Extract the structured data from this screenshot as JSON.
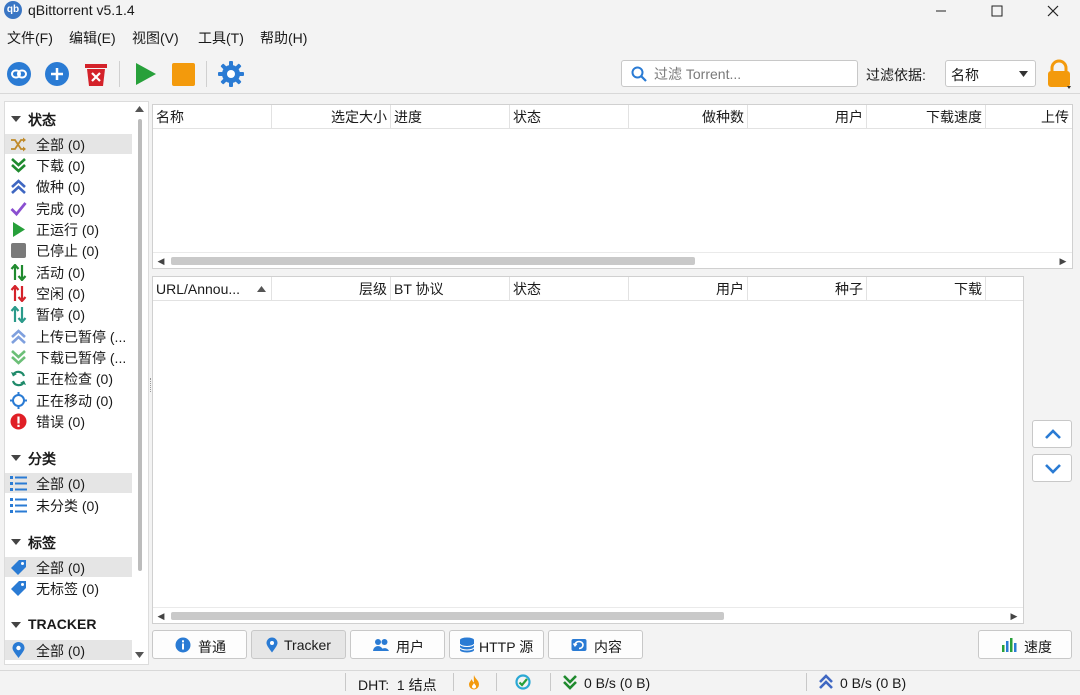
{
  "window": {
    "title": "qBittorrent v5.1.4",
    "app_icon_text": "qb"
  },
  "menu": [
    "文件(F)",
    "编辑(E)",
    "视图(V)",
    "工具(T)",
    "帮助(H)"
  ],
  "toolbar": {
    "search_placeholder": "过滤 Torrent...",
    "filter_label": "过滤依据:",
    "filter_value": "名称"
  },
  "sidebar": {
    "status_title": "状态",
    "status_items": [
      {
        "label": "全部 (0)",
        "icon": "shuffle-icon"
      },
      {
        "label": "下载 (0)",
        "icon": "double-chevron-down-icon"
      },
      {
        "label": "做种 (0)",
        "icon": "double-chevron-up-icon"
      },
      {
        "label": "完成 (0)",
        "icon": "checkmark-icon"
      },
      {
        "label": "正运行 (0)",
        "icon": "play-icon"
      },
      {
        "label": "已停止 (0)",
        "icon": "stop-icon"
      },
      {
        "label": "活动 (0)",
        "icon": "arrows-updown-icon"
      },
      {
        "label": "空闲 (0)",
        "icon": "arrows-updown-red-icon"
      },
      {
        "label": "暂停 (0)",
        "icon": "arrows-updown-teal-icon"
      },
      {
        "label": "上传已暂停 (...",
        "icon": "double-chevron-up-light-icon"
      },
      {
        "label": "下载已暂停 (...",
        "icon": "double-chevron-down-light-icon"
      },
      {
        "label": "正在检查 (0)",
        "icon": "refresh-icon"
      },
      {
        "label": "正在移动 (0)",
        "icon": "move-icon"
      },
      {
        "label": "错误 (0)",
        "icon": "error-icon"
      }
    ],
    "category_title": "分类",
    "category_items": [
      {
        "label": "全部 (0)",
        "icon": "list-icon"
      },
      {
        "label": "未分类 (0)",
        "icon": "list-icon"
      }
    ],
    "tag_title": "标签",
    "tag_items": [
      {
        "label": "全部 (0)",
        "icon": "tag-icon"
      },
      {
        "label": "无标签 (0)",
        "icon": "tag-icon"
      }
    ],
    "tracker_title": "TRACKER",
    "tracker_items": [
      {
        "label": "全部 (0)",
        "icon": "location-pin-icon"
      }
    ]
  },
  "torrent_table": {
    "columns": [
      "名称",
      "选定大小",
      "进度",
      "状态",
      "做种数",
      "用户",
      "下载速度",
      "上传"
    ]
  },
  "tracker_table": {
    "columns": [
      "URL/Annou...",
      "层级",
      "BT 协议",
      "状态",
      "用户",
      "种子",
      "下载"
    ]
  },
  "tabs": [
    "普通",
    "Tracker",
    "用户",
    "HTTP 源",
    "内容"
  ],
  "speed_button": "速度",
  "statusbar": {
    "dht": "DHT:  1 结点",
    "download": "0 B/s (0 B)",
    "upload": "0 B/s (0 B)"
  },
  "colors": {
    "accent_blue": "#2a7bd4",
    "green": "#27a03a",
    "orange": "#f39a0c",
    "red": "#d4222a"
  }
}
